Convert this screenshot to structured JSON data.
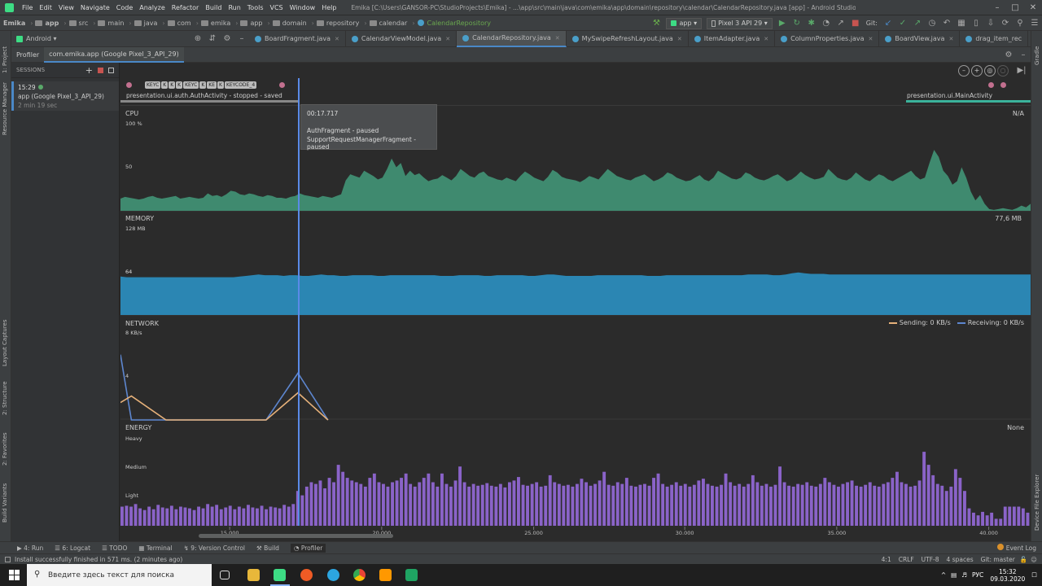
{
  "app": {
    "title": "Emika [C:\\Users\\GANSOR-PC\\StudioProjects\\Emika] - ...\\app\\src\\main\\java\\com\\emika\\app\\domain\\repository\\calendar\\CalendarRepository.java [app] - Android Studio",
    "menu": [
      "File",
      "Edit",
      "View",
      "Navigate",
      "Code",
      "Analyze",
      "Refactor",
      "Build",
      "Run",
      "Tools",
      "VCS",
      "Window",
      "Help"
    ]
  },
  "breadcrumbs": [
    "Emika",
    "app",
    "src",
    "main",
    "java",
    "com",
    "emika",
    "app",
    "domain",
    "repository",
    "calendar",
    "CalendarRepository"
  ],
  "toolbar": {
    "run_config": "app",
    "device": "Pixel 3 API 29",
    "git_label": "Git:"
  },
  "project_view": {
    "label": "Android"
  },
  "editor_tabs": [
    {
      "label": "BoardFragment.java",
      "active": false
    },
    {
      "label": "CalendarViewModel.java",
      "active": false
    },
    {
      "label": "CalendarRepository.java",
      "active": true
    },
    {
      "label": "MySwipeRefreshLayout.java",
      "active": false
    },
    {
      "label": "ItemAdapter.java",
      "active": false
    },
    {
      "label": "ColumnProperties.java",
      "active": false
    },
    {
      "label": "BoardView.java",
      "active": false
    },
    {
      "label": "drag_item_rec",
      "active": false
    }
  ],
  "left_strip": [
    "1: Project",
    "Resource Manager",
    "Layout Captures",
    "2: Structure",
    "2: Favorites",
    "Build Variants"
  ],
  "right_strip": [
    "Gradle",
    "Device File Explorer"
  ],
  "profiler": {
    "tab_profiler": "Profiler",
    "tab_session": "com.emika.app (Google Pixel_3_API_29)",
    "sessions_label": "SESSIONS",
    "session": {
      "time": "15:29",
      "name": "app (Google Pixel_3_API_29)",
      "duration": "2 min 19 sec"
    }
  },
  "events": {
    "activity_left": "presentation.ui.auth.AuthActivity - stopped - saved",
    "activity_right": "presentation.ui.MainActivity",
    "keys": [
      "KEYC",
      "K",
      "K",
      "K",
      "KEYC",
      "K",
      "KE",
      "K",
      "KEYCODE_4"
    ]
  },
  "tooltip": {
    "time": "00:17.717",
    "line1": "AuthFragment - paused",
    "line2": "SupportRequestManagerFragment - paused"
  },
  "cpu": {
    "label": "CPU",
    "max": "100 %",
    "mid": "50",
    "value": "N/A"
  },
  "memory": {
    "label": "MEMORY",
    "max": "128 MB",
    "mid": "64",
    "value": "77,6 MB"
  },
  "network": {
    "label": "NETWORK",
    "max": "8 KB/s",
    "mid": "4",
    "sending": "Sending: 0 KB/s",
    "receiving": "Receiving: 0 KB/s"
  },
  "energy": {
    "label": "ENERGY",
    "value": "None",
    "heavy": "Heavy",
    "medium": "Medium",
    "light": "Light"
  },
  "colors": {
    "cpu": "#3f8a6f",
    "memory": "#2b86b3",
    "energy": "#8a63c8",
    "net_send": "#e6b17a",
    "net_recv": "#5d86cf",
    "cursor": "#5a8ae8"
  },
  "chart_data": {
    "type": "area",
    "x_ticks": [
      "15.000",
      "20.000",
      "25.000",
      "30.000",
      "35.000",
      "40.000"
    ],
    "cursor_time": "00:17.717",
    "cpu": [
      14,
      16,
      15,
      14,
      13,
      14,
      16,
      17,
      15,
      14,
      15,
      16,
      17,
      14,
      15,
      16,
      15,
      14,
      15,
      20,
      17,
      18,
      16,
      19,
      23,
      22,
      19,
      18,
      20,
      19,
      17,
      16,
      18,
      17,
      15,
      15,
      14,
      16,
      17,
      20,
      18,
      17,
      16,
      15,
      17,
      16,
      15,
      17,
      19,
      35,
      42,
      40,
      38,
      46,
      43,
      40,
      36,
      38,
      48,
      60,
      50,
      55,
      40,
      46,
      41,
      43,
      38,
      34,
      36,
      37,
      41,
      38,
      35,
      40,
      48,
      44,
      40,
      38,
      43,
      45,
      40,
      38,
      36,
      35,
      38,
      36,
      34,
      40,
      45,
      42,
      38,
      36,
      34,
      39,
      47,
      44,
      39,
      37,
      36,
      35,
      33,
      36,
      40,
      38,
      36,
      42,
      48,
      44,
      40,
      38,
      36,
      35,
      38,
      40,
      42,
      38,
      34,
      36,
      39,
      44,
      42,
      38,
      36,
      34,
      35,
      38,
      41,
      36,
      34,
      38,
      46,
      43,
      40,
      37,
      36,
      38,
      44,
      42,
      38,
      36,
      35,
      37,
      40,
      42,
      38,
      34,
      36,
      40,
      45,
      41,
      38,
      36,
      37,
      39,
      48,
      43,
      38,
      36,
      35,
      38,
      44,
      40,
      36,
      34,
      38,
      42,
      40,
      36,
      34,
      37,
      40,
      43,
      46,
      40,
      36,
      38,
      55,
      70,
      62,
      46,
      40,
      30,
      34,
      50,
      38,
      22,
      12,
      18,
      8,
      2,
      1,
      2,
      3,
      2,
      1,
      3,
      6,
      4,
      8
    ],
    "memory": [
      57,
      56,
      56,
      56,
      56,
      56,
      56,
      56,
      56,
      56,
      56,
      56,
      56,
      56,
      56,
      56,
      56,
      56,
      56,
      57,
      58,
      59,
      60,
      59,
      59,
      59,
      58,
      59,
      59,
      58,
      58,
      59,
      60,
      59,
      59,
      58,
      58,
      59,
      59,
      59,
      59,
      58,
      58,
      59,
      59,
      59,
      59,
      59,
      59,
      59,
      59,
      58,
      58,
      58,
      59,
      59,
      59,
      59,
      58,
      58,
      59,
      59,
      59,
      59,
      59,
      58,
      58,
      59,
      60,
      60,
      59,
      58,
      58,
      58,
      58,
      58,
      59,
      59,
      59,
      59,
      59,
      59,
      59,
      59,
      58,
      58,
      58,
      59,
      59,
      59,
      59,
      59,
      59,
      59,
      59,
      59,
      59,
      59,
      59,
      59,
      60,
      60,
      60,
      60,
      59,
      59,
      60,
      62,
      63,
      62,
      61,
      61,
      61,
      60,
      60,
      60,
      60,
      60,
      60,
      60,
      60,
      60,
      60,
      60,
      60,
      60,
      60,
      60,
      60,
      60,
      60,
      60,
      60,
      60,
      60,
      60,
      60,
      60,
      60,
      60,
      60,
      60,
      60,
      60,
      60,
      60
    ],
    "network_receiving": [
      {
        "t": 0,
        "v": 6
      },
      {
        "t": 0.012,
        "v": 0
      },
      {
        "t": 0.16,
        "v": 0
      },
      {
        "t": 0.195,
        "v": 4.3
      },
      {
        "t": 0.228,
        "v": 0
      }
    ],
    "network_sending": [
      {
        "t": 0,
        "v": 1.6
      },
      {
        "t": 0.012,
        "v": 2.2
      },
      {
        "t": 0.05,
        "v": 0
      },
      {
        "t": 0.16,
        "v": 0
      },
      {
        "t": 0.195,
        "v": 2.5
      },
      {
        "t": 0.228,
        "v": 0
      }
    ],
    "energy": [
      22,
      23,
      22,
      25,
      20,
      18,
      22,
      19,
      24,
      21,
      20,
      23,
      19,
      22,
      21,
      20,
      18,
      22,
      20,
      25,
      22,
      24,
      19,
      21,
      23,
      19,
      22,
      20,
      24,
      21,
      20,
      23,
      19,
      22,
      21,
      20,
      24,
      22,
      25,
      40,
      35,
      45,
      50,
      48,
      52,
      43,
      55,
      50,
      70,
      62,
      55,
      52,
      50,
      48,
      45,
      55,
      60,
      50,
      48,
      45,
      50,
      52,
      55,
      60,
      48,
      45,
      50,
      55,
      60,
      50,
      45,
      60,
      48,
      45,
      52,
      68,
      50,
      45,
      48,
      46,
      47,
      49,
      46,
      45,
      48,
      44,
      50,
      52,
      56,
      47,
      46,
      48,
      50,
      45,
      46,
      58,
      50,
      48,
      46,
      47,
      45,
      48,
      54,
      50,
      46,
      48,
      52,
      62,
      47,
      46,
      50,
      48,
      55,
      46,
      45,
      47,
      48,
      46,
      55,
      60,
      48,
      45,
      47,
      50,
      46,
      48,
      45,
      47,
      52,
      54,
      48,
      46,
      45,
      47,
      60,
      50,
      46,
      48,
      45,
      48,
      58,
      50,
      46,
      48,
      45,
      47,
      68,
      50,
      46,
      45,
      48,
      47,
      50,
      46,
      45,
      48,
      55,
      50,
      47,
      45,
      48,
      50,
      52,
      46,
      45,
      47,
      50,
      46,
      45,
      48,
      50,
      55,
      62,
      50,
      48,
      45,
      46,
      52,
      85,
      70,
      58,
      48,
      46,
      40,
      45,
      65,
      55,
      40,
      20,
      15,
      12,
      16,
      12,
      15,
      8,
      8,
      22,
      22,
      22,
      22,
      20,
      15
    ]
  }
}
